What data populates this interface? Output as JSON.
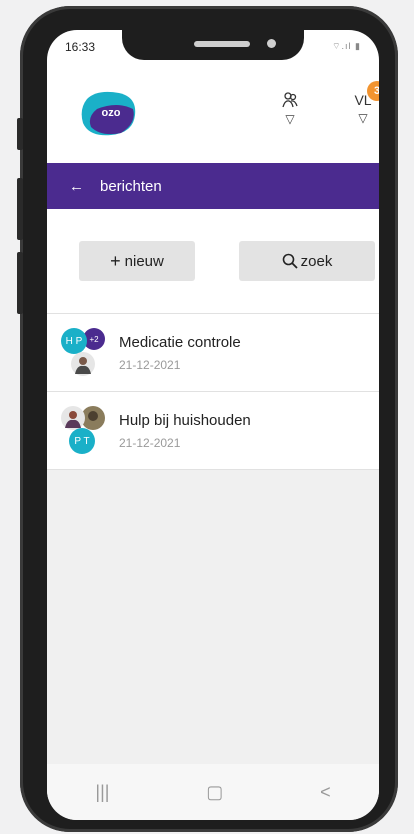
{
  "status": {
    "time": "16:33",
    "icons": "⌔.ıl ▮"
  },
  "header": {
    "logo_text": "ozo",
    "user_initials": "VL",
    "notification_count": "3"
  },
  "navbar": {
    "back_icon": "←",
    "title": "berichten"
  },
  "actions": {
    "new_icon": "+",
    "new_label": "nieuw",
    "search_label": "zoek"
  },
  "messages": [
    {
      "title": "Medicatie controle",
      "date": "21-12-2021",
      "avatar_initials": "H P",
      "avatar_extra": "+2"
    },
    {
      "title": "Hulp bij huishouden",
      "date": "21-12-2021",
      "avatar_initials": "P T"
    }
  ],
  "bottom_nav": {
    "recents": "|||",
    "home": "▢",
    "back": "<"
  },
  "colors": {
    "accent": "#4b2b8f",
    "badge": "#f29430",
    "avatar_teal": "#1ab0c8"
  }
}
